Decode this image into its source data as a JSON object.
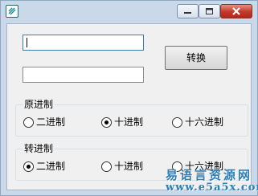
{
  "window": {
    "title": "",
    "icon": "app-icon",
    "caption_buttons": [
      "minimize-icon",
      "maximize-icon",
      "close-icon"
    ]
  },
  "inputs": {
    "top": {
      "value": "",
      "placeholder": ""
    },
    "bottom": {
      "value": "",
      "placeholder": ""
    }
  },
  "convert_button": {
    "label": "转换"
  },
  "source_group": {
    "label": "原进制",
    "options": [
      "二进制",
      "十进制",
      "十六进制"
    ],
    "selected": "十进制"
  },
  "target_group": {
    "label": "转进制",
    "options": [
      "二进制",
      "十进制",
      "十六进制"
    ],
    "selected": "二进制"
  },
  "watermark": {
    "line1": "易语言资源网",
    "line2": "www.e5a5x.com"
  },
  "colors": {
    "frame": "#c9d9ea",
    "client": "#f0f0f0",
    "close_button": "#c1372a",
    "watermark": "#2c7fb8"
  }
}
